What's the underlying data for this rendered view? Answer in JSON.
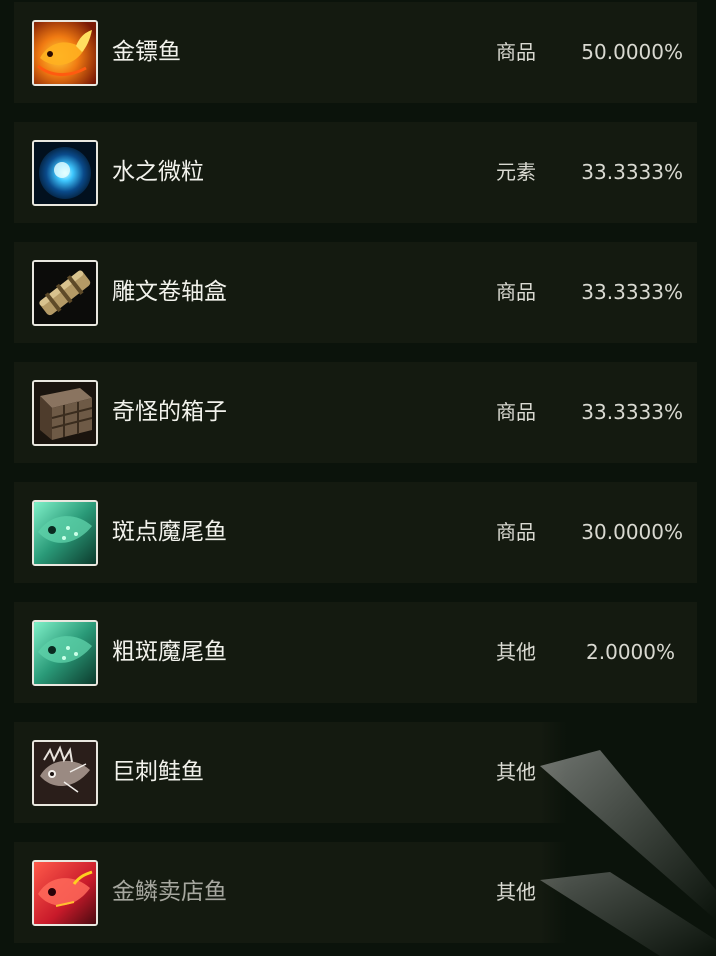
{
  "items": [
    {
      "name": "金镖鱼",
      "category": "商品",
      "rate": "50.0000%",
      "icon": "golden-fish-icon"
    },
    {
      "name": "水之微粒",
      "category": "元素",
      "rate": "33.3333%",
      "icon": "water-mote-icon"
    },
    {
      "name": "雕文卷轴盒",
      "category": "商品",
      "rate": "33.3333%",
      "icon": "scroll-case-icon"
    },
    {
      "name": "奇怪的箱子",
      "category": "商品",
      "rate": "33.3333%",
      "icon": "wooden-crate-icon"
    },
    {
      "name": "斑点魔尾鱼",
      "category": "商品",
      "rate": "30.0000%",
      "icon": "spotted-fish-icon"
    },
    {
      "name": "粗斑魔尾鱼",
      "category": "其他",
      "rate": "2.0000%",
      "icon": "spotted-fish-icon"
    },
    {
      "name": "巨刺鲑鱼",
      "category": "其他",
      "rate": "",
      "icon": "spiny-salmon-icon"
    },
    {
      "name": "金鳞卖店鱼",
      "category": "其他",
      "rate": "",
      "icon": "red-fish-icon"
    }
  ],
  "colors": {
    "background": "#0b130b",
    "row": "#141a10",
    "text": "#f2f2ec",
    "dim_text": "#a6a79f"
  }
}
